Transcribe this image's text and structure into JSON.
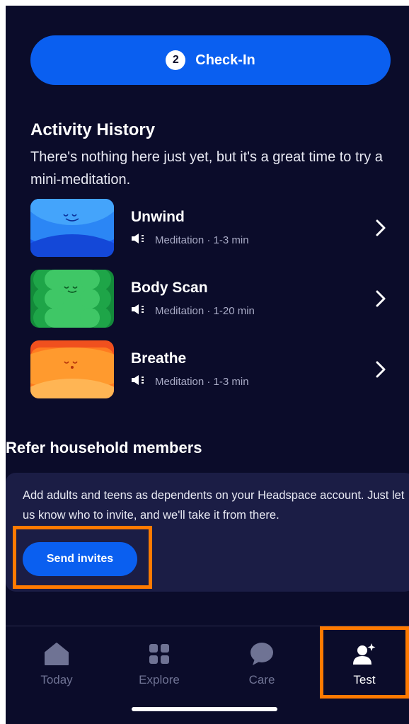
{
  "checkin": {
    "step": "2",
    "label": "Check-In"
  },
  "activity_history": {
    "title": "Activity History",
    "description": "There's nothing here just yet, but it's a great time to try a mini-meditation.",
    "items": [
      {
        "name": "Unwind",
        "meta": "Meditation · 1-3 min"
      },
      {
        "name": "Body Scan",
        "meta": "Meditation · 1-20 min"
      },
      {
        "name": "Breathe",
        "meta": "Meditation · 1-3 min"
      }
    ]
  },
  "refer": {
    "title": "Refer household members",
    "description": "Add adults and teens as dependents on your Headspace account. Just let us know who to invite, and we'll take it from there.",
    "button_label": "Send invites"
  },
  "tabs": [
    {
      "label": "Today",
      "icon": "home-icon"
    },
    {
      "label": "Explore",
      "icon": "grid-icon"
    },
    {
      "label": "Care",
      "icon": "chat-bubble-icon"
    },
    {
      "label": "Test",
      "icon": "person-sparkle-icon",
      "active": true
    }
  ],
  "colors": {
    "background": "#0b0c2a",
    "accent_blue": "#0a5ff0",
    "card": "#1b1d45",
    "highlight": "#ff7a00"
  }
}
